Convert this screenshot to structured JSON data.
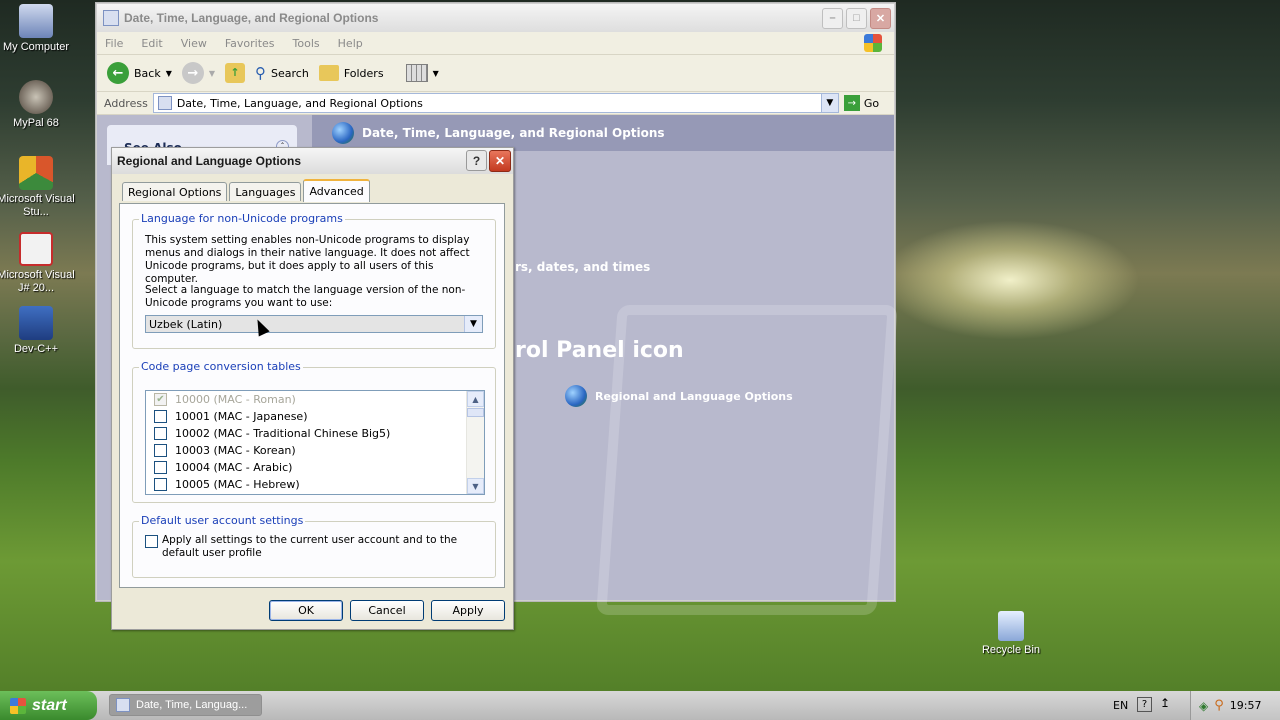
{
  "desktop": {
    "icons": [
      {
        "label": "My Computer"
      },
      {
        "label": "MyPal 68"
      },
      {
        "label": "Microsoft Visual Stu..."
      },
      {
        "label": "Microsoft Visual J# 20..."
      },
      {
        "label": "Dev-C++"
      },
      {
        "label": "Recycle Bin"
      }
    ]
  },
  "explorer": {
    "title": "Date, Time, Language, and Regional Options",
    "menu": [
      "File",
      "Edit",
      "View",
      "Favorites",
      "Tools",
      "Help"
    ],
    "toolbar": {
      "back": "Back",
      "search": "Search",
      "folders": "Folders"
    },
    "address": {
      "label": "Address",
      "value": "Date, Time, Language, and Regional Options",
      "go": "Go"
    },
    "see_also": "See Also",
    "header": "Date, Time, Language, and Regional Options",
    "bg_text_1": "rs, dates, and times",
    "bg_text_2": "rol Panel icon",
    "regional_link": "Regional and Language Options"
  },
  "dialog": {
    "title": "Regional and Language Options",
    "tabs": [
      "Regional Options",
      "Languages",
      "Advanced"
    ],
    "group1": {
      "title": "Language for non-Unicode programs",
      "desc": "This system setting enables non-Unicode programs to display menus and dialogs in their native language. It does not affect Unicode programs, but it does apply to all users of this computer.",
      "prompt": "Select a language to match the language version of the non-Unicode programs you want to use:",
      "selected": "Uzbek (Latin)"
    },
    "group2": {
      "title": "Code page conversion tables",
      "items": [
        {
          "label": "10000 (MAC - Roman)",
          "checked": true,
          "disabled": true
        },
        {
          "label": "10001 (MAC - Japanese)",
          "checked": false
        },
        {
          "label": "10002 (MAC - Traditional Chinese Big5)",
          "checked": false
        },
        {
          "label": "10003 (MAC - Korean)",
          "checked": false
        },
        {
          "label": "10004 (MAC - Arabic)",
          "checked": false
        },
        {
          "label": "10005 (MAC - Hebrew)",
          "checked": false
        }
      ]
    },
    "group3": {
      "title": "Default user account settings",
      "checkbox": "Apply all settings to the current user account and to the default user profile"
    },
    "buttons": {
      "ok": "OK",
      "cancel": "Cancel",
      "apply": "Apply"
    }
  },
  "taskbar": {
    "start": "start",
    "task": "Date, Time, Languag...",
    "lang": "EN",
    "clock": "19:57"
  }
}
